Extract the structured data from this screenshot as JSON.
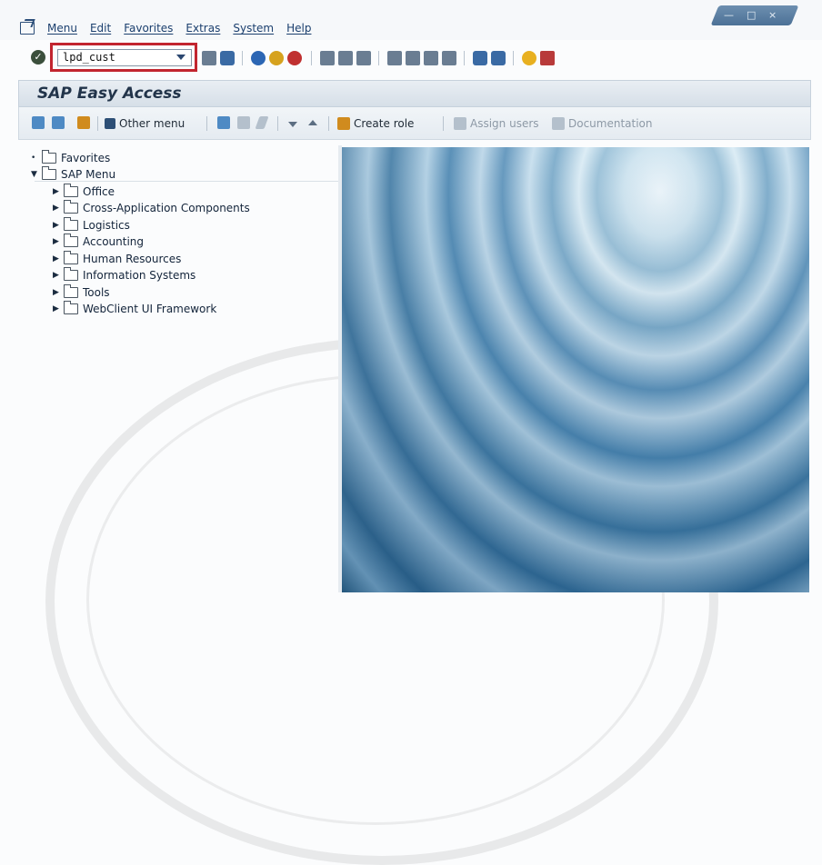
{
  "menubar": {
    "items": [
      "Menu",
      "Edit",
      "Favorites",
      "Extras",
      "System",
      "Help"
    ],
    "window_controls": [
      "—",
      "□",
      "×"
    ]
  },
  "toolbar": {
    "command_value": "lpd_cust"
  },
  "header": {
    "title": "SAP Easy Access"
  },
  "app_toolbar": {
    "other_menu": "Other menu",
    "create_role": "Create role",
    "assign_users": "Assign users",
    "documentation": "Documentation"
  },
  "tree": {
    "favorites": "Favorites",
    "sap_menu": "SAP Menu",
    "items": [
      "Office",
      "Cross-Application Components",
      "Logistics",
      "Accounting",
      "Human Resources",
      "Information Systems",
      "Tools",
      "WebClient UI Framework"
    ]
  },
  "colors": {
    "highlight_border": "#c2252f",
    "header_bg": "#dfe6ee",
    "link": "#1b3f6e"
  }
}
